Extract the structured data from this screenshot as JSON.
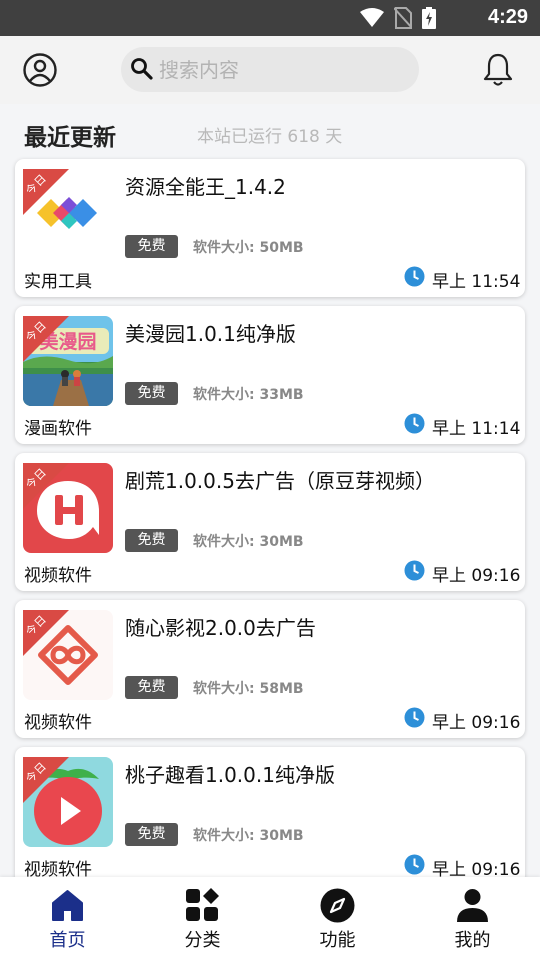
{
  "status_bar": {
    "time": "4:29",
    "icons": [
      "wifi-icon",
      "no-sim-icon",
      "battery-charging-icon"
    ]
  },
  "header": {
    "avatar_icon": "user-circle-icon",
    "search_placeholder": "搜索内容",
    "search_value": "",
    "bell_icon": "bell-icon"
  },
  "section": {
    "title": "最近更新",
    "uptime": "本站已运行 618 天"
  },
  "ribbon_text": "今日",
  "items": [
    {
      "title": "资源全能王_1.4.2",
      "badge": "免费",
      "size": "软件大小: 50MB",
      "category": "实用工具",
      "time": "早上 11:54",
      "icon": "colorful-diamonds-app-icon"
    },
    {
      "title": "美漫园1.0.1纯净版",
      "badge": "免费",
      "size": "软件大小: 33MB",
      "category": "漫画软件",
      "time": "早上 11:14",
      "icon": "meimanyuan-app-icon"
    },
    {
      "title": "剧荒1.0.0.5去广告（原豆芽视频）",
      "badge": "免费",
      "size": "软件大小: 30MB",
      "category": "视频软件",
      "time": "早上 09:16",
      "icon": "juhuang-h-app-icon"
    },
    {
      "title": "随心影视2.0.0去广告",
      "badge": "免费",
      "size": "软件大小: 58MB",
      "category": "视频软件",
      "time": "早上 09:16",
      "icon": "suixin-knot-app-icon"
    },
    {
      "title": "桃子趣看1.0.0.1纯净版",
      "badge": "免费",
      "size": "软件大小: 30MB",
      "category": "视频软件",
      "time": "早上 09:16",
      "icon": "peach-play-app-icon"
    }
  ],
  "nav": [
    {
      "label": "首页",
      "icon": "home-icon",
      "active": true
    },
    {
      "label": "分类",
      "icon": "category-grid-icon",
      "active": false
    },
    {
      "label": "功能",
      "icon": "compass-icon",
      "active": false
    },
    {
      "label": "我的",
      "icon": "person-icon",
      "active": false
    }
  ],
  "colors": {
    "accent": "#1b2f8a",
    "ribbon": "#d94a44",
    "badge": "#555555",
    "clock": "#2d8fd8",
    "status_bar": "#404040"
  }
}
